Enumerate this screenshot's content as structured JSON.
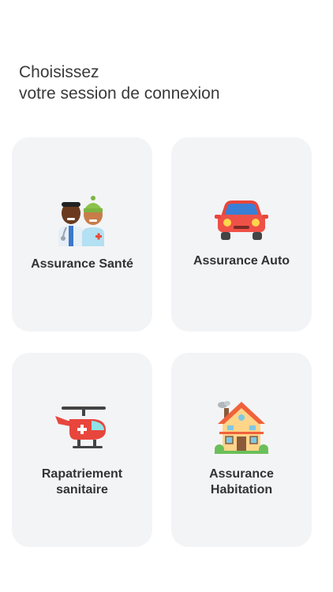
{
  "heading": {
    "line1": "Choisissez",
    "line2": "votre session de connexion"
  },
  "cards": [
    {
      "label": "Assurance Santé",
      "icon": "doctors-icon"
    },
    {
      "label": "Assurance Auto",
      "icon": "car-icon"
    },
    {
      "label": "Rapatriement\nsanitaire",
      "icon": "medical-helicopter-icon"
    },
    {
      "label": "Assurance\nHabitation",
      "icon": "house-icon"
    }
  ]
}
